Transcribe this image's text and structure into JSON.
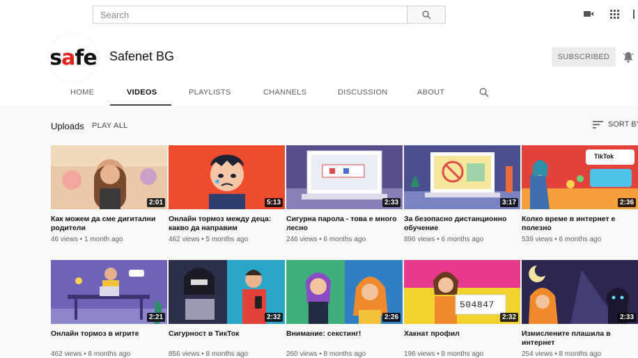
{
  "search": {
    "placeholder": "Search"
  },
  "icons": {
    "search": "search-icon",
    "create": "video-camera-icon",
    "apps": "apps-grid-icon",
    "more": "more-vertical-icon",
    "bell": "bell-icon",
    "sort": "sort-icon"
  },
  "channel": {
    "logo_text_start": "s",
    "logo_text_accent": "a",
    "logo_text_end": "fe",
    "name": "Safenet BG",
    "subscribed_label": "SUBSCRIBED"
  },
  "tabs": [
    {
      "label": "HOME"
    },
    {
      "label": "VIDEOS"
    },
    {
      "label": "PLAYLISTS"
    },
    {
      "label": "CHANNELS"
    },
    {
      "label": "DISCUSSION"
    },
    {
      "label": "ABOUT"
    }
  ],
  "section": {
    "title": "Uploads",
    "play_all": "PLAY ALL",
    "sort_label": "SORT BY"
  },
  "colors": {
    "brand_red": "#e2231a",
    "tab_underline": "#444444",
    "subscribed_bg": "#ececec"
  },
  "videos": [
    {
      "title": "Как можем да сме дигитални родители",
      "views": "46 views",
      "age": "1 month ago",
      "duration": "2:01"
    },
    {
      "title": "Онлайн тормоз между деца: какво да направим",
      "views": "462 views",
      "age": "5 months ago",
      "duration": "5:13"
    },
    {
      "title": "Сигурна парола - това е много лесно",
      "views": "246 views",
      "age": "6 months ago",
      "duration": "2:33"
    },
    {
      "title": "За безопасно дистанционно обучение",
      "views": "896 views",
      "age": "6 months ago",
      "duration": "3:17"
    },
    {
      "title": "Колко време в интернет е полезно",
      "views": "539 views",
      "age": "6 months ago",
      "duration": "2:36"
    },
    {
      "title": "Онлайн тормоз в игрите",
      "views": "462 views",
      "age": "8 months ago",
      "duration": "2:21"
    },
    {
      "title": "Сигурност в ТикТок",
      "views": "856 views",
      "age": "8 months ago",
      "duration": "2:32"
    },
    {
      "title": "Внимание: секстинг!",
      "views": "260 views",
      "age": "8 months ago",
      "duration": "2:26"
    },
    {
      "title": "Хакнат профил",
      "views": "196 views",
      "age": "8 months ago",
      "duration": "2:32"
    },
    {
      "title": "Измислените плашила в интернет",
      "views": "254 views",
      "age": "8 months ago",
      "duration": "2:33"
    }
  ],
  "thumbnail_text": {
    "tiktok": "TikTok",
    "code": "504847"
  }
}
